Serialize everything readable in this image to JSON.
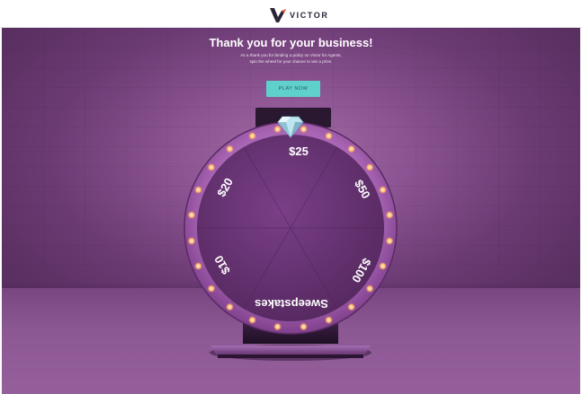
{
  "header": {
    "brand_name": "VICTOR",
    "logo_icon": "victor-v-logo",
    "brand_colors": {
      "v_dark": "#2a2336",
      "v_orange": "#e8613b"
    }
  },
  "hero": {
    "title": "Thank you for your business!",
    "subtitle_line1": "As a thank you for binding a policy on Victor for Agents,",
    "subtitle_line2": "spin the wheel for your chance to win a prize.",
    "play_button_label": "PLAY NOW",
    "accent_color": "#5fd0cc",
    "background_color": "#8a5391"
  },
  "wheel": {
    "pointer_icon": "diamond-pointer-icon",
    "segments": [
      {
        "label": "$25"
      },
      {
        "label": "$50"
      },
      {
        "label": "$100"
      },
      {
        "label": "Sweepstakes"
      },
      {
        "label": "$10"
      },
      {
        "label": "$20"
      }
    ],
    "rim_color": "#9a56a8",
    "face_color": "#6a3577",
    "light_color": "#ffb36b",
    "light_count": 24
  }
}
